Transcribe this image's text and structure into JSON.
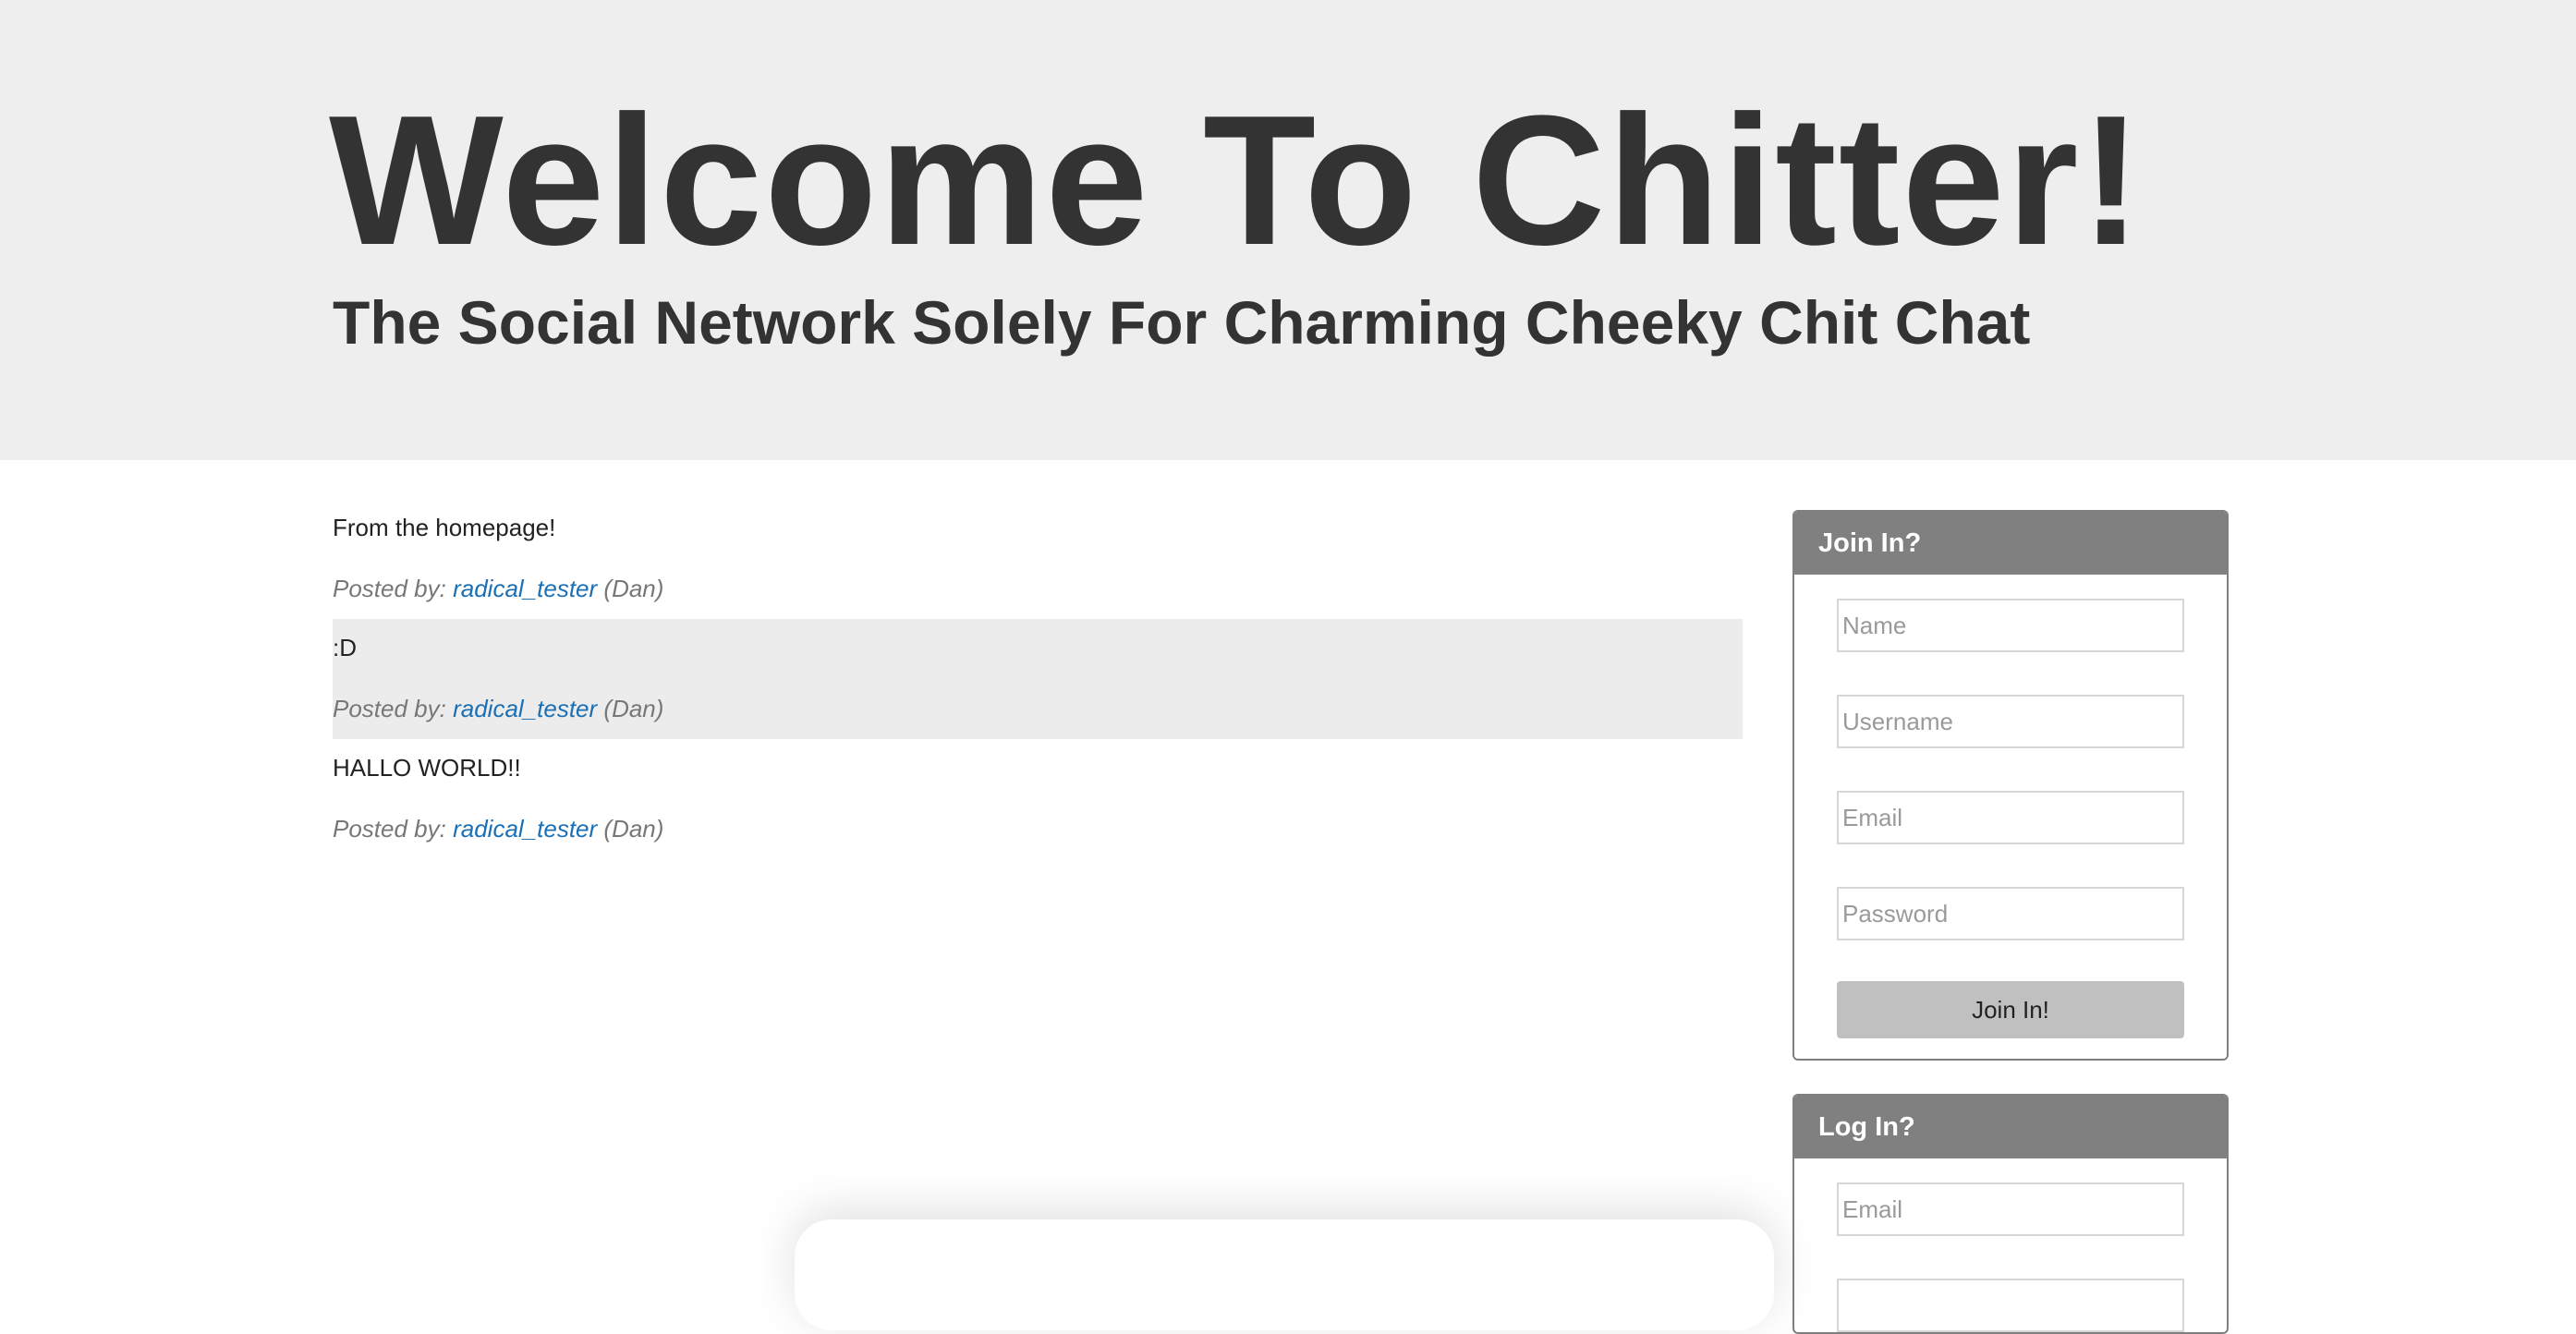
{
  "header": {
    "title": "Welcome To Chitter!",
    "subtitle": "The Social Network Solely For Charming Cheeky Chit Chat"
  },
  "posts": [
    {
      "text": "From the homepage!",
      "posted_by_label": "Posted by:",
      "username": "radical_tester",
      "name": "(Dan)"
    },
    {
      "text": ":D",
      "posted_by_label": "Posted by:",
      "username": "radical_tester",
      "name": "(Dan)"
    },
    {
      "text": "HALLO WORLD!!",
      "posted_by_label": "Posted by:",
      "username": "radical_tester",
      "name": "(Dan)"
    }
  ],
  "join_panel": {
    "title": "Join In?",
    "name_placeholder": "Name",
    "username_placeholder": "Username",
    "email_placeholder": "Email",
    "password_placeholder": "Password",
    "button_label": "Join In!"
  },
  "login_panel": {
    "title": "Log In?",
    "email_placeholder": "Email"
  },
  "colors": {
    "hero_background": "#eeeeee",
    "panel_header": "#808080",
    "link": "#1a6fb5",
    "button": "#c0c0c0"
  }
}
